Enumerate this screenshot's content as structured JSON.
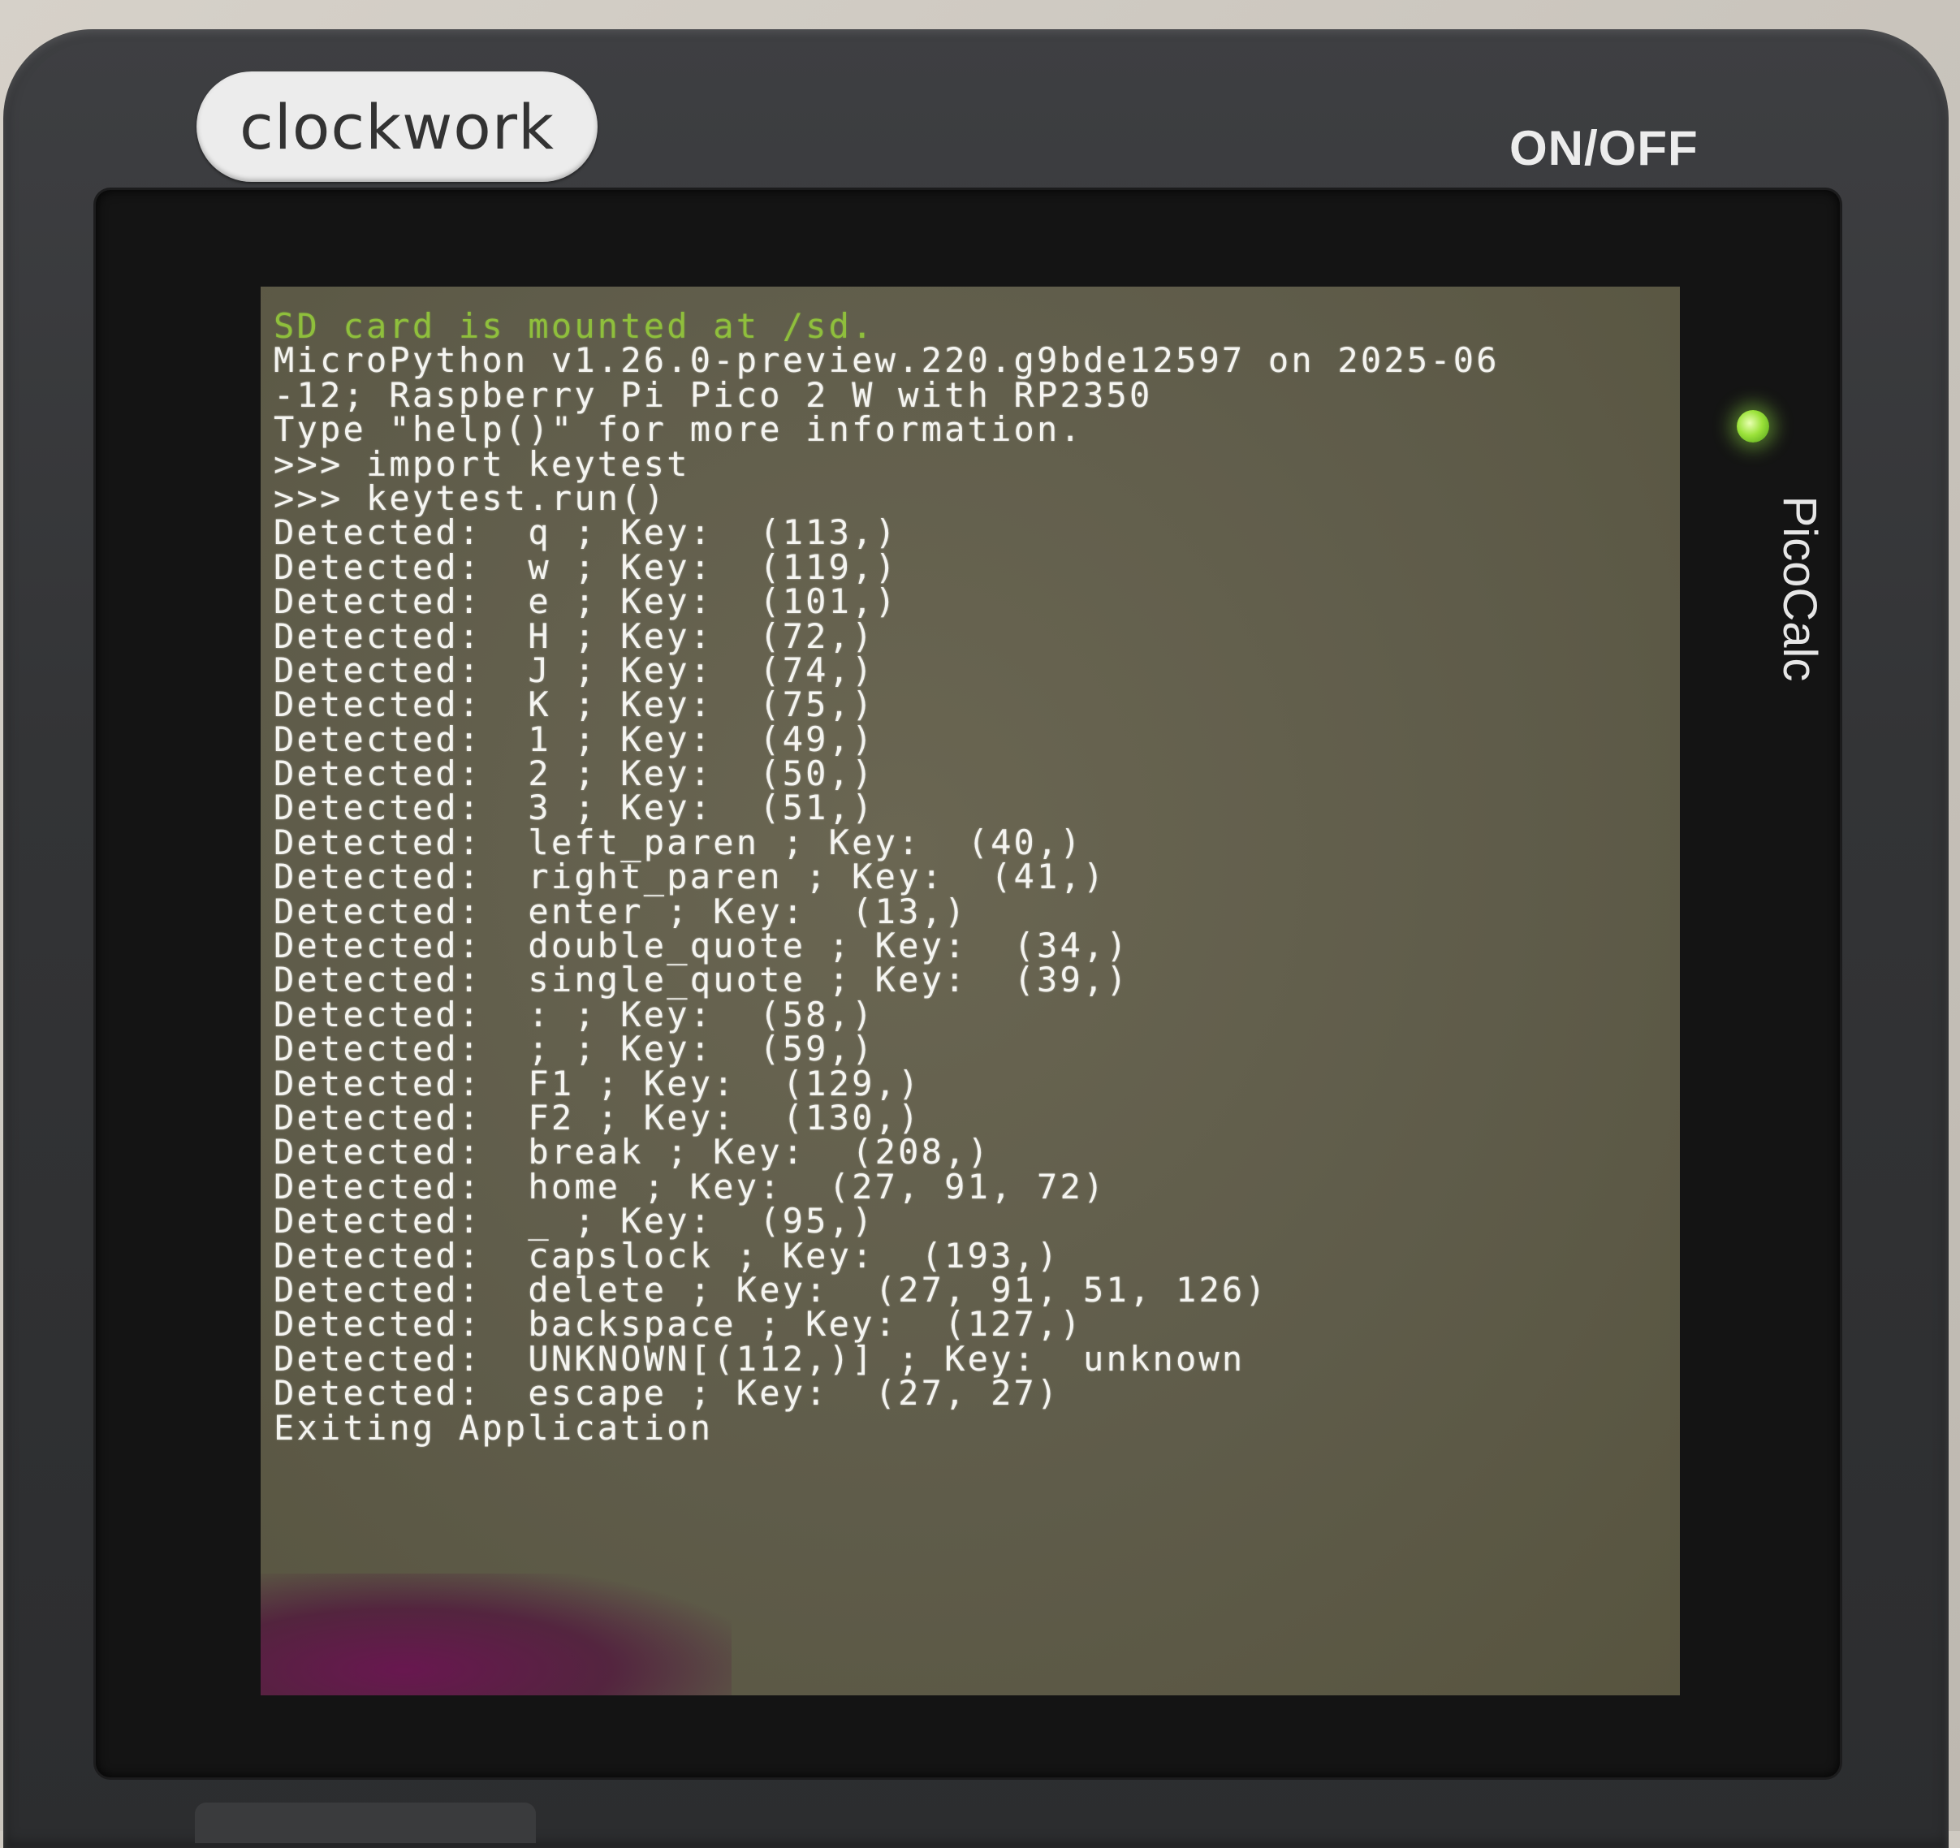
{
  "device": {
    "logo": "clockwork",
    "power_label": "ON/OFF",
    "brand": "PicoCalc",
    "led_color": "#9be23a"
  },
  "terminal": {
    "status_line": "SD card is mounted at /sd.",
    "lines": [
      "MicroPython v1.26.0-preview.220.g9bde12597 on 2025-06",
      "-12; Raspberry Pi Pico 2 W with RP2350",
      "Type \"help()\" for more information.",
      ">>> import keytest",
      ">>> keytest.run()",
      "Detected:  q ; Key:  (113,)",
      "Detected:  w ; Key:  (119,)",
      "Detected:  e ; Key:  (101,)",
      "Detected:  H ; Key:  (72,)",
      "Detected:  J ; Key:  (74,)",
      "Detected:  K ; Key:  (75,)",
      "Detected:  1 ; Key:  (49,)",
      "Detected:  2 ; Key:  (50,)",
      "Detected:  3 ; Key:  (51,)",
      "Detected:  left_paren ; Key:  (40,)",
      "Detected:  right_paren ; Key:  (41,)",
      "Detected:  enter ; Key:  (13,)",
      "Detected:  double_quote ; Key:  (34,)",
      "Detected:  single_quote ; Key:  (39,)",
      "Detected:  : ; Key:  (58,)",
      "Detected:  ; ; Key:  (59,)",
      "Detected:  F1 ; Key:  (129,)",
      "Detected:  F2 ; Key:  (130,)",
      "Detected:  break ; Key:  (208,)",
      "Detected:  home ; Key:  (27, 91, 72)",
      "Detected:  _ ; Key:  (95,)",
      "Detected:  capslock ; Key:  (193,)",
      "Detected:  delete ; Key:  (27, 91, 51, 126)",
      "Detected:  backspace ; Key:  (127,)",
      "Detected:  UNKNOWN[(112,)] ; Key:  unknown",
      "Detected:  escape ; Key:  (27, 27)",
      "Exiting Application",
      ">>>"
    ]
  }
}
